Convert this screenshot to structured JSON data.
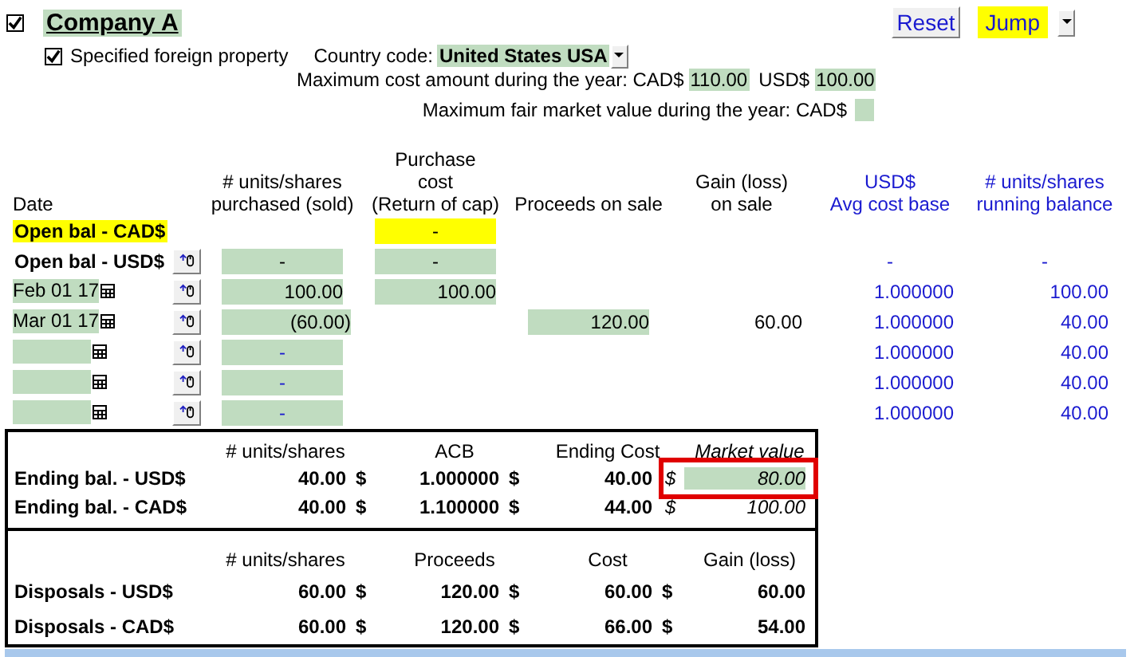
{
  "company": {
    "title": "Company A",
    "checked": true
  },
  "buttons": [
    {
      "label": "Reset",
      "kind": "plain"
    },
    {
      "label": "Jump",
      "kind": "highlight"
    }
  ],
  "foreign_property": {
    "label": "Specified foreign property",
    "checked": true
  },
  "country": {
    "label": "Country code:",
    "value": "United States USA"
  },
  "max_cost": {
    "label": "Maximum cost amount during the year: CAD$",
    "cad": "110.00",
    "usd_label": "USD$",
    "usd": "100.00"
  },
  "max_fmv": {
    "label": "Maximum fair market value during the year: CAD$"
  },
  "columns": [
    {
      "lines": [
        "Date"
      ],
      "kind": "input"
    },
    {
      "lines": [
        "# units/shares",
        "purchased (sold)"
      ],
      "kind": "input"
    },
    {
      "lines": [
        "Purchase",
        "cost",
        "(Return of cap)"
      ],
      "kind": "input"
    },
    {
      "lines": [
        "Proceeds on sale"
      ],
      "kind": "input"
    },
    {
      "lines": [
        "Gain (loss)",
        "on sale"
      ],
      "kind": "input"
    },
    {
      "lines": [
        "USD$",
        "Avg cost base"
      ],
      "kind": "computed"
    },
    {
      "lines": [
        "# units/shares",
        "running balance"
      ],
      "kind": "computed"
    }
  ],
  "rows": [
    {
      "kind": "opening",
      "label": "Open bal - CAD$",
      "highlighted": true,
      "cost": "-"
    },
    {
      "kind": "opening",
      "label": "Open bal - USD$",
      "highlighted": false,
      "units": "-",
      "cost": "-",
      "avg_cost": "-",
      "balance": "-"
    },
    {
      "kind": "entry",
      "date": "Feb 01 17",
      "units": "100.00",
      "cost": "100.00",
      "avg_cost": "1.000000",
      "balance": "100.00"
    },
    {
      "kind": "entry",
      "date": "Mar 01 17",
      "units": "(60.00)",
      "proceeds": "120.00",
      "gain": "60.00",
      "avg_cost": "1.000000",
      "balance": "40.00"
    },
    {
      "kind": "entry",
      "units": "-",
      "avg_cost": "1.000000",
      "balance": "40.00"
    },
    {
      "kind": "entry",
      "units": "-",
      "avg_cost": "1.000000",
      "balance": "40.00"
    },
    {
      "kind": "entry",
      "units": "-",
      "avg_cost": "1.000000",
      "balance": "40.00"
    }
  ],
  "ending": {
    "columns": [
      {
        "label": "# units/shares",
        "italic": false
      },
      {
        "label": "ACB",
        "italic": false
      },
      {
        "label": "Ending Cost",
        "italic": false
      },
      {
        "label": "Market value",
        "italic": true
      }
    ],
    "rows": [
      {
        "label": "Ending bal. - USD$",
        "cells": [
          {
            "text": "40.00"
          },
          {
            "symbol": "$",
            "text": "1.000000"
          },
          {
            "symbol": "$",
            "text": "40.00"
          },
          {
            "symbol": "$",
            "text": "80.00",
            "italic": true,
            "highlighted": true
          }
        ]
      },
      {
        "label": "Ending bal. - CAD$",
        "cells": [
          {
            "text": "40.00"
          },
          {
            "symbol": "$",
            "text": "1.100000"
          },
          {
            "symbol": "$",
            "text": "44.00"
          },
          {
            "symbol": "$",
            "text": "100.00",
            "italic": true,
            "highlighted": false
          }
        ]
      }
    ]
  },
  "disposals": {
    "columns": [
      {
        "label": "# units/shares",
        "italic": false
      },
      {
        "label": "Proceeds",
        "italic": false
      },
      {
        "label": "Cost",
        "italic": false
      },
      {
        "label": "Gain (loss)",
        "italic": false
      }
    ],
    "rows": [
      {
        "label": "Disposals - USD$",
        "cells": [
          {
            "text": "60.00"
          },
          {
            "symbol": "$",
            "text": "120.00"
          },
          {
            "symbol": "$",
            "text": "60.00"
          },
          {
            "symbol": "$",
            "text": "60.00"
          }
        ]
      },
      {
        "label": "Disposals - CAD$",
        "cells": [
          {
            "text": "60.00"
          },
          {
            "symbol": "$",
            "text": "120.00"
          },
          {
            "symbol": "$",
            "text": "66.00"
          },
          {
            "symbol": "$",
            "text": "54.00"
          }
        ]
      }
    ]
  }
}
